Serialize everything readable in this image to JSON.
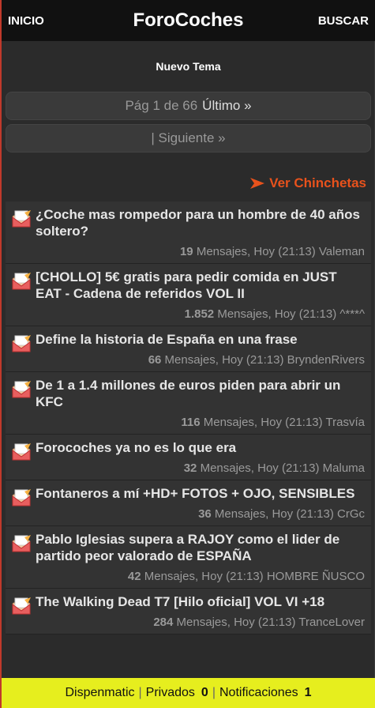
{
  "header": {
    "left_link": "INICIO",
    "title": "ForoCoches",
    "right_link": "BUSCAR"
  },
  "new_topic_label": "Nuevo Tema",
  "pagination": {
    "page_text": "Pág 1 de 66",
    "last_label": "Último »",
    "next_label": "| Siguiente »"
  },
  "sticky_label": "Ver Chinchetas",
  "threads": [
    {
      "title": "¿Coche mas rompedor para un hombre de 40 años soltero?",
      "count": "19",
      "meta": "Mensajes, Hoy (21:13) Valeman"
    },
    {
      "title": "[CHOLLO] 5€ gratis para pedir comida en JUST EAT - Cadena de referidos VOL II",
      "count": "1.852",
      "meta": "Mensajes, Hoy (21:13) ^***^"
    },
    {
      "title": "Define la historia de España en una frase",
      "count": "66",
      "meta": "Mensajes, Hoy (21:13) BryndenRivers"
    },
    {
      "title": "De 1 a 1.4 millones de euros piden para abrir un KFC",
      "count": "116",
      "meta": "Mensajes, Hoy (21:13) Trasvía"
    },
    {
      "title": "Forocoches ya no es lo que era",
      "count": "32",
      "meta": "Mensajes, Hoy (21:13) Maluma"
    },
    {
      "title": "Fontaneros a mí +HD+ FOTOS + OJO, SENSIBLES",
      "count": "36",
      "meta": "Mensajes, Hoy (21:13) CrGc"
    },
    {
      "title": "Pablo Iglesias supera a RAJOY como el lider de partido peor valorado de ESPAÑA",
      "count": "42",
      "meta": "Mensajes, Hoy (21:13) HOMBRE ÑUSCO"
    },
    {
      "title": "The Walking Dead T7 [Hilo oficial] VOL VI +18",
      "count": "284",
      "meta": "Mensajes, Hoy (21:13) TranceLover"
    }
  ],
  "footer": {
    "user": "Dispenmatic",
    "private_label": "Privados",
    "private_count": "0",
    "notif_label": "Notificaciones",
    "notif_count": "1"
  },
  "colors": {
    "accent_orange": "#e8521c",
    "footer_yellow": "#e6ee1e",
    "header_bg": "#111111"
  },
  "icons": {
    "thread": "thread-envelope-icon",
    "sticky_arrow": "arrow-right-icon"
  }
}
